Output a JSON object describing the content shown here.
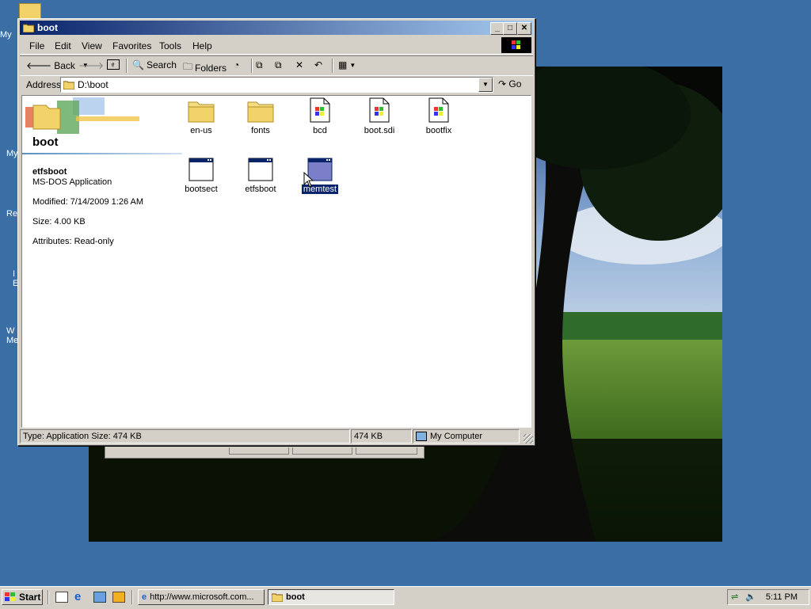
{
  "desktop": {
    "icons": [
      "My",
      "My",
      "Re",
      "I E",
      "W Me"
    ]
  },
  "window": {
    "title": "boot",
    "menu": [
      "File",
      "Edit",
      "View",
      "Favorites",
      "Tools",
      "Help"
    ],
    "toolbar": {
      "back": "Back",
      "search": "Search",
      "folders": "Folders"
    },
    "address": {
      "label": "Address",
      "value": "D:\\boot",
      "go": "Go"
    },
    "info": {
      "folder_title": "boot",
      "file_name": "etfsboot",
      "file_type": "MS-DOS Application",
      "modified": "Modified: 7/14/2009 1:26 AM",
      "size": "Size: 4.00 KB",
      "attributes": "Attributes: Read-only"
    },
    "files": [
      {
        "name": "en-us",
        "type": "folder"
      },
      {
        "name": "fonts",
        "type": "folder"
      },
      {
        "name": "bcd",
        "type": "file"
      },
      {
        "name": "boot.sdi",
        "type": "file"
      },
      {
        "name": "bootfix",
        "type": "file"
      },
      {
        "name": "bootsect",
        "type": "app"
      },
      {
        "name": "etfsboot",
        "type": "app"
      },
      {
        "name": "memtest",
        "type": "app",
        "selected": true
      }
    ],
    "status": {
      "left": "Type: Application Size: 474 KB",
      "size": "474 KB",
      "zone": "My Computer"
    }
  },
  "taskbar": {
    "start": "Start",
    "tasks": [
      {
        "label": "http://www.microsoft.com...",
        "active": false
      },
      {
        "label": "boot",
        "active": true
      }
    ],
    "clock": "5:11 PM"
  },
  "colors": {
    "desktop": "#3a6ea5",
    "title_active": "#0a246a",
    "face": "#d4d0c8",
    "selection": "#0a246a"
  }
}
